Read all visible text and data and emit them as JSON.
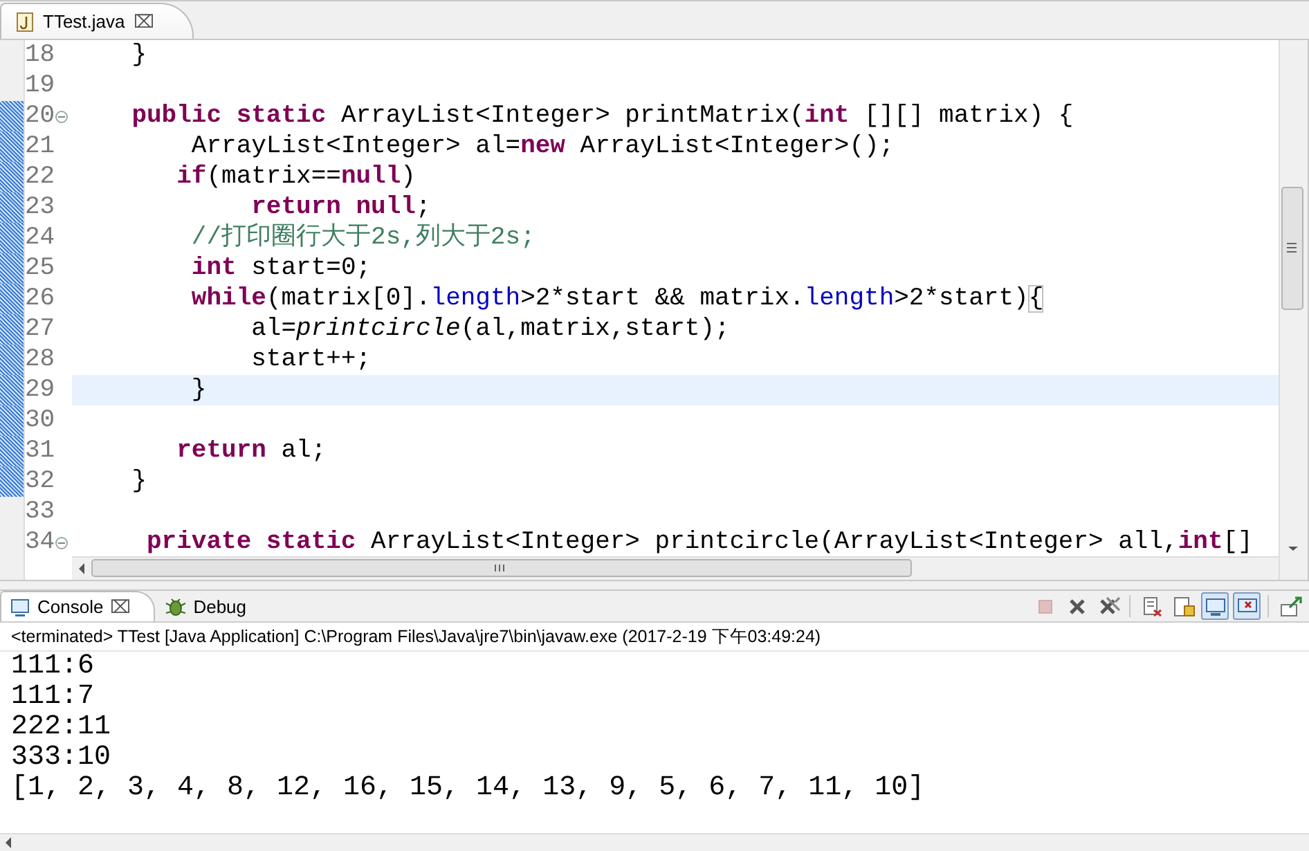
{
  "editor_tab": {
    "title": "TTest.java",
    "close": "⌧"
  },
  "lines": [
    {
      "number": "18",
      "fold": false,
      "range_marker": false,
      "current": false,
      "tokens": [
        {
          "text": "    }",
          "kind": "plain"
        }
      ]
    },
    {
      "number": "19",
      "fold": false,
      "range_marker": false,
      "current": false
    },
    {
      "number": "20",
      "fold": true,
      "range_marker": true,
      "current": false,
      "tokens": [
        {
          "text": "    public static",
          "kind": "keyword"
        },
        {
          "text": " ArrayList<Integer> printMatrix(",
          "kind": "plain"
        },
        {
          "text": "int",
          "kind": "keyword"
        },
        {
          "text": " [][] matrix) {",
          "kind": "plain"
        }
      ]
    },
    {
      "number": "21",
      "fold": false,
      "range_marker": true,
      "current": false,
      "tokens": [
        {
          "text": "        ArrayList<Integer> al=",
          "kind": "plain"
        },
        {
          "text": "new",
          "kind": "keyword"
        },
        {
          "text": " ArrayList<Integer>();",
          "kind": "plain"
        }
      ]
    },
    {
      "number": "22",
      "fold": false,
      "range_marker": true,
      "current": false,
      "tokens": [
        {
          "text": "       if",
          "kind": "keyword"
        },
        {
          "text": "(matrix==",
          "kind": "plain"
        },
        {
          "text": "null",
          "kind": "keyword"
        },
        {
          "text": ")",
          "kind": "plain"
        }
      ]
    },
    {
      "number": "23",
      "fold": false,
      "range_marker": true,
      "current": false,
      "tokens": [
        {
          "text": "            return null",
          "kind": "keyword"
        },
        {
          "text": ";",
          "kind": "plain"
        }
      ]
    },
    {
      "number": "24",
      "fold": false,
      "range_marker": true,
      "current": false,
      "tokens": [
        {
          "text": "        //打印圈行大于2s,列大于2s;",
          "kind": "comment"
        }
      ]
    },
    {
      "number": "25",
      "fold": false,
      "range_marker": true,
      "current": false,
      "tokens": [
        {
          "text": "        int",
          "kind": "keyword"
        },
        {
          "text": " start=0;",
          "kind": "plain"
        }
      ]
    },
    {
      "number": "26",
      "fold": false,
      "range_marker": true,
      "current": false,
      "tokens": [
        {
          "text": "        while",
          "kind": "keyword"
        },
        {
          "text": "(matrix[0].",
          "kind": "plain"
        },
        {
          "text": "length",
          "kind": "field"
        },
        {
          "text": ">2*start && matrix.",
          "kind": "plain"
        },
        {
          "text": "length",
          "kind": "field"
        },
        {
          "text": ">2*start)",
          "kind": "plain"
        },
        {
          "text": "{",
          "kind": "bracket"
        }
      ]
    },
    {
      "number": "27",
      "fold": false,
      "range_marker": true,
      "current": false,
      "tokens": [
        {
          "text": "            al=",
          "kind": "plain"
        },
        {
          "text": "printcircle",
          "kind": "static-call"
        },
        {
          "text": "(al,matrix,start);",
          "kind": "plain"
        }
      ]
    },
    {
      "number": "28",
      "fold": false,
      "range_marker": true,
      "current": false,
      "tokens": [
        {
          "text": "            start++;",
          "kind": "plain"
        }
      ]
    },
    {
      "number": "29",
      "fold": false,
      "range_marker": true,
      "current": true,
      "tokens": [
        {
          "text": "        }",
          "kind": "plain"
        }
      ]
    },
    {
      "number": "30",
      "fold": false,
      "range_marker": true,
      "current": false
    },
    {
      "number": "31",
      "fold": false,
      "range_marker": true,
      "current": false,
      "tokens": [
        {
          "text": "       return",
          "kind": "keyword"
        },
        {
          "text": " al;",
          "kind": "plain"
        }
      ]
    },
    {
      "number": "32",
      "fold": false,
      "range_marker": true,
      "current": false,
      "tokens": [
        {
          "text": "    }",
          "kind": "plain"
        }
      ]
    },
    {
      "number": "33",
      "fold": false,
      "range_marker": false,
      "current": false
    },
    {
      "number": "34",
      "fold": true,
      "range_marker": false,
      "current": false,
      "tokens": [
        {
          "text": "     private static",
          "kind": "keyword"
        },
        {
          "text": " ArrayList<Integer> printcircle(ArrayList<Integer> all,",
          "kind": "plain"
        },
        {
          "text": "int",
          "kind": "keyword"
        },
        {
          "text": "[]",
          "kind": "plain"
        }
      ]
    }
  ],
  "console_tabs": [
    {
      "label": "Console",
      "kind": "console",
      "close": "⌧",
      "selected": true
    },
    {
      "label": "Debug",
      "kind": "debug",
      "selected": false
    }
  ],
  "console_toolbar": [
    {
      "kind": "terminate",
      "disabled": true,
      "on": false
    },
    {
      "kind": "remove",
      "disabled": false,
      "on": false
    },
    {
      "kind": "remove-all",
      "disabled": false,
      "on": false
    },
    {
      "kind": "word-wrap",
      "disabled": false,
      "on": false
    },
    {
      "kind": "scroll-lock",
      "disabled": false,
      "on": false
    },
    {
      "kind": "show-out",
      "disabled": false,
      "on": true
    },
    {
      "kind": "show-err",
      "disabled": false,
      "on": true
    },
    {
      "kind": "pin",
      "disabled": false,
      "on": false
    }
  ],
  "console_status": "<terminated> TTest [Java Application] C:\\Program Files\\Java\\jre7\\bin\\javaw.exe (2017-2-19 下午03:49:24)",
  "console_output": [
    "111:6",
    "111:7",
    "222:11",
    "333:10",
    "[1, 2, 3, 4, 8, 12, 16, 15, 14, 13, 9, 5, 6, 7, 11, 10]"
  ]
}
